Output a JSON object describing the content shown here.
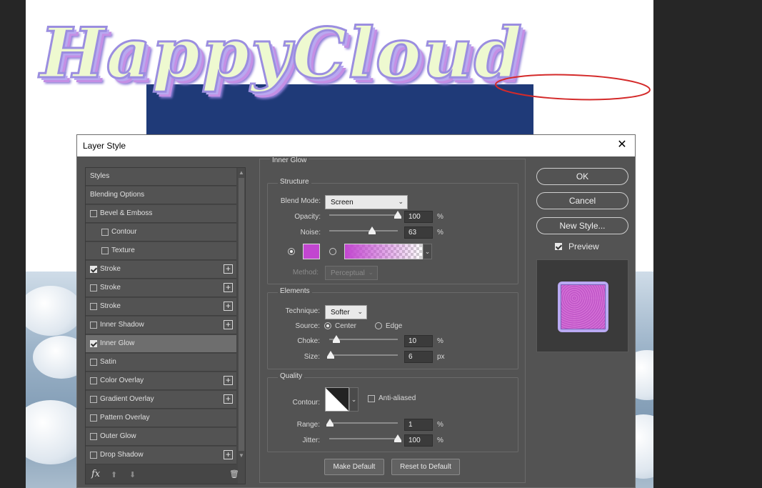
{
  "artwork": {
    "text": "HappyCloud"
  },
  "dialog": {
    "title": "Layer Style",
    "close": "✕"
  },
  "styles_list": {
    "items": [
      {
        "label": "Styles",
        "checkbox": false,
        "checked": false,
        "plus": false,
        "selected": false
      },
      {
        "label": "Blending Options",
        "checkbox": false,
        "checked": false,
        "plus": false,
        "selected": false
      },
      {
        "label": "Bevel & Emboss",
        "checkbox": true,
        "checked": false,
        "plus": false,
        "selected": false
      },
      {
        "label": "Contour",
        "checkbox": true,
        "checked": false,
        "plus": false,
        "selected": false
      },
      {
        "label": "Texture",
        "checkbox": true,
        "checked": false,
        "plus": false,
        "selected": false
      },
      {
        "label": "Stroke",
        "checkbox": true,
        "checked": true,
        "plus": true,
        "selected": false
      },
      {
        "label": "Stroke",
        "checkbox": true,
        "checked": false,
        "plus": true,
        "selected": false
      },
      {
        "label": "Stroke",
        "checkbox": true,
        "checked": false,
        "plus": true,
        "selected": false
      },
      {
        "label": "Inner Shadow",
        "checkbox": true,
        "checked": false,
        "plus": true,
        "selected": false
      },
      {
        "label": "Inner Glow",
        "checkbox": true,
        "checked": true,
        "plus": false,
        "selected": true
      },
      {
        "label": "Satin",
        "checkbox": true,
        "checked": false,
        "plus": false,
        "selected": false
      },
      {
        "label": "Color Overlay",
        "checkbox": true,
        "checked": false,
        "plus": true,
        "selected": false
      },
      {
        "label": "Gradient Overlay",
        "checkbox": true,
        "checked": false,
        "plus": true,
        "selected": false
      },
      {
        "label": "Pattern Overlay",
        "checkbox": true,
        "checked": false,
        "plus": false,
        "selected": false
      },
      {
        "label": "Outer Glow",
        "checkbox": true,
        "checked": false,
        "plus": false,
        "selected": false
      },
      {
        "label": "Drop Shadow",
        "checkbox": true,
        "checked": false,
        "plus": true,
        "selected": false
      }
    ],
    "footer": {
      "fx": "fx",
      "up": "⬆",
      "down": "⬇",
      "trash": "🗑"
    }
  },
  "inner_glow": {
    "section_title": "Inner Glow",
    "structure": {
      "title": "Structure",
      "blend_mode_label": "Blend Mode:",
      "blend_mode": "Screen",
      "opacity_label": "Opacity:",
      "opacity": "100",
      "opacity_unit": "%",
      "opacity_fraction": 1.0,
      "noise_label": "Noise:",
      "noise": "63",
      "noise_unit": "%",
      "noise_fraction": 0.63,
      "glow_color": "#c246d0",
      "method_label": "Method:",
      "method": "Perceptual"
    },
    "elements": {
      "title": "Elements",
      "technique_label": "Technique:",
      "technique": "Softer",
      "source_label": "Source:",
      "source_center": "Center",
      "source_edge": "Edge",
      "choke_label": "Choke:",
      "choke": "10",
      "choke_unit": "%",
      "choke_fraction": 0.1,
      "size_label": "Size:",
      "size": "6",
      "size_unit": "px",
      "size_fraction": 0.024
    },
    "quality": {
      "title": "Quality",
      "contour_label": "Contour:",
      "anti_aliased": "Anti-aliased",
      "range_label": "Range:",
      "range": "1",
      "range_unit": "%",
      "range_fraction": 0.01,
      "jitter_label": "Jitter:",
      "jitter": "100",
      "jitter_unit": "%",
      "jitter_fraction": 1.0
    },
    "make_default": "Make Default",
    "reset_default": "Reset to Default"
  },
  "actions": {
    "ok": "OK",
    "cancel": "Cancel",
    "new_style": "New Style...",
    "preview": "Preview"
  }
}
